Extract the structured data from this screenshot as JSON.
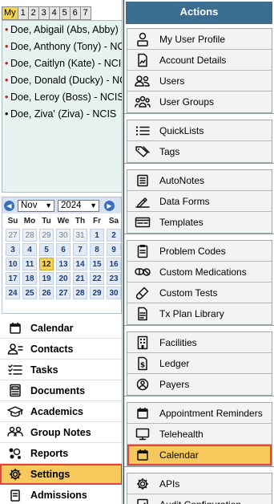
{
  "left": {
    "tabs": [
      "My",
      "1",
      "2",
      "3",
      "4",
      "5",
      "6",
      "7"
    ],
    "patients": [
      {
        "name": "Doe, Abigail (Abs, Abby) -",
        "marker": "red"
      },
      {
        "name": "Doe, Anthony (Tony) - NC",
        "marker": "red"
      },
      {
        "name": "Doe, Caitlyn (Kate) - NCIS",
        "marker": "red"
      },
      {
        "name": "Doe, Donald (Ducky) - NC",
        "marker": "red"
      },
      {
        "name": "Doe, Leroy (Boss) - NCIS",
        "marker": "red"
      },
      {
        "name": "Doe, Ziva' (Ziva) - NCIS",
        "marker": "black"
      }
    ],
    "calendar": {
      "month": "Nov",
      "year": "2024",
      "weekdays": [
        "Su",
        "Mo",
        "Tu",
        "We",
        "Th",
        "Fr",
        "Sa"
      ],
      "weeks": [
        [
          {
            "d": "27",
            "o": true
          },
          {
            "d": "28",
            "o": true
          },
          {
            "d": "29",
            "o": true
          },
          {
            "d": "30",
            "o": true
          },
          {
            "d": "31",
            "o": true
          },
          {
            "d": "1"
          },
          {
            "d": "2"
          }
        ],
        [
          {
            "d": "3"
          },
          {
            "d": "4"
          },
          {
            "d": "5"
          },
          {
            "d": "6"
          },
          {
            "d": "7"
          },
          {
            "d": "8"
          },
          {
            "d": "9"
          }
        ],
        [
          {
            "d": "10"
          },
          {
            "d": "11"
          },
          {
            "d": "12",
            "t": true
          },
          {
            "d": "13"
          },
          {
            "d": "14"
          },
          {
            "d": "15"
          },
          {
            "d": "16"
          }
        ],
        [
          {
            "d": "17"
          },
          {
            "d": "18"
          },
          {
            "d": "19"
          },
          {
            "d": "20"
          },
          {
            "d": "21"
          },
          {
            "d": "22"
          },
          {
            "d": "23"
          }
        ],
        [
          {
            "d": "24"
          },
          {
            "d": "25"
          },
          {
            "d": "26"
          },
          {
            "d": "27"
          },
          {
            "d": "28"
          },
          {
            "d": "29"
          },
          {
            "d": "30"
          }
        ]
      ]
    },
    "nav": [
      {
        "label": "Calendar",
        "icon": "calendar-icon"
      },
      {
        "label": "Contacts",
        "icon": "contacts-icon"
      },
      {
        "label": "Tasks",
        "icon": "tasks-icon"
      },
      {
        "label": "Documents",
        "icon": "documents-icon"
      },
      {
        "label": "Academics",
        "icon": "academics-icon"
      },
      {
        "label": "Group Notes",
        "icon": "group-notes-icon"
      },
      {
        "label": "Reports",
        "icon": "reports-icon"
      },
      {
        "label": "Settings",
        "icon": "gear-icon",
        "active": true
      },
      {
        "label": "Admissions",
        "icon": "admissions-icon"
      }
    ]
  },
  "actions": {
    "header": "Actions",
    "groups": [
      [
        {
          "label": "My User Profile",
          "icon": "user-profile-icon"
        },
        {
          "label": "Account Details",
          "icon": "account-details-icon"
        },
        {
          "label": "Users",
          "icon": "users-icon"
        },
        {
          "label": "User Groups",
          "icon": "user-groups-icon"
        }
      ],
      [
        {
          "label": "QuickLists",
          "icon": "list-icon"
        },
        {
          "label": "Tags",
          "icon": "tags-icon"
        }
      ],
      [
        {
          "label": "AutoNotes",
          "icon": "autonotes-icon"
        },
        {
          "label": "Data Forms",
          "icon": "data-forms-icon"
        },
        {
          "label": "Templates",
          "icon": "templates-icon"
        }
      ],
      [
        {
          "label": "Problem Codes",
          "icon": "clipboard-icon"
        },
        {
          "label": "Custom Medications",
          "icon": "pill-icon"
        },
        {
          "label": "Custom Tests",
          "icon": "test-tube-icon"
        },
        {
          "label": "Tx Plan Library",
          "icon": "library-icon"
        }
      ],
      [
        {
          "label": "Facilities",
          "icon": "building-icon"
        },
        {
          "label": "Ledger",
          "icon": "ledger-icon"
        },
        {
          "label": "Payers",
          "icon": "payers-icon"
        }
      ],
      [
        {
          "label": "Appointment Reminders",
          "icon": "reminder-icon"
        },
        {
          "label": "Telehealth",
          "icon": "monitor-icon"
        },
        {
          "label": "Calendar",
          "icon": "calendar-icon",
          "active": true
        }
      ],
      [
        {
          "label": "APIs",
          "icon": "gear-icon"
        },
        {
          "label": "Audit Configuration",
          "icon": "audit-icon"
        }
      ]
    ]
  }
}
